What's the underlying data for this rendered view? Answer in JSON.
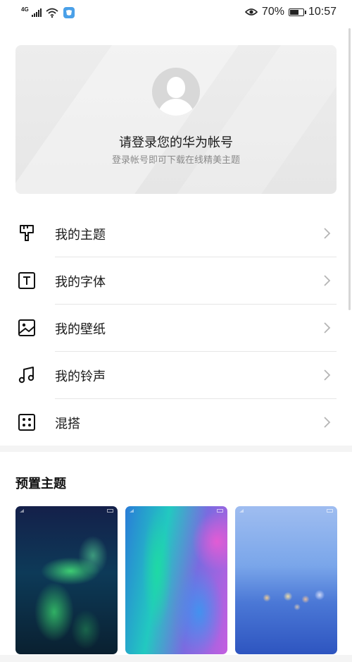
{
  "status_bar": {
    "network": "4G",
    "battery": "70%",
    "battery_level": 0.7,
    "time": "10:57"
  },
  "account": {
    "title": "请登录您的华为帐号",
    "subtitle": "登录帐号即可下载在线精美主题"
  },
  "menu": [
    {
      "label": "我的主题",
      "icon": "paint-brush-icon"
    },
    {
      "label": "我的字体",
      "icon": "text-font-icon"
    },
    {
      "label": "我的壁纸",
      "icon": "picture-icon"
    },
    {
      "label": "我的铃声",
      "icon": "music-note-icon"
    },
    {
      "label": "混搭",
      "icon": "dice-grid-icon"
    }
  ],
  "preset": {
    "title": "预置主题",
    "themes": [
      {
        "name": "aurora-theme"
      },
      {
        "name": "gradient-theme"
      },
      {
        "name": "bokeh-lake-theme"
      }
    ]
  },
  "colors": {
    "card_bg": "#e8e8e8",
    "divider": "#e6e6e6",
    "muted_text": "#8a8a8a"
  }
}
